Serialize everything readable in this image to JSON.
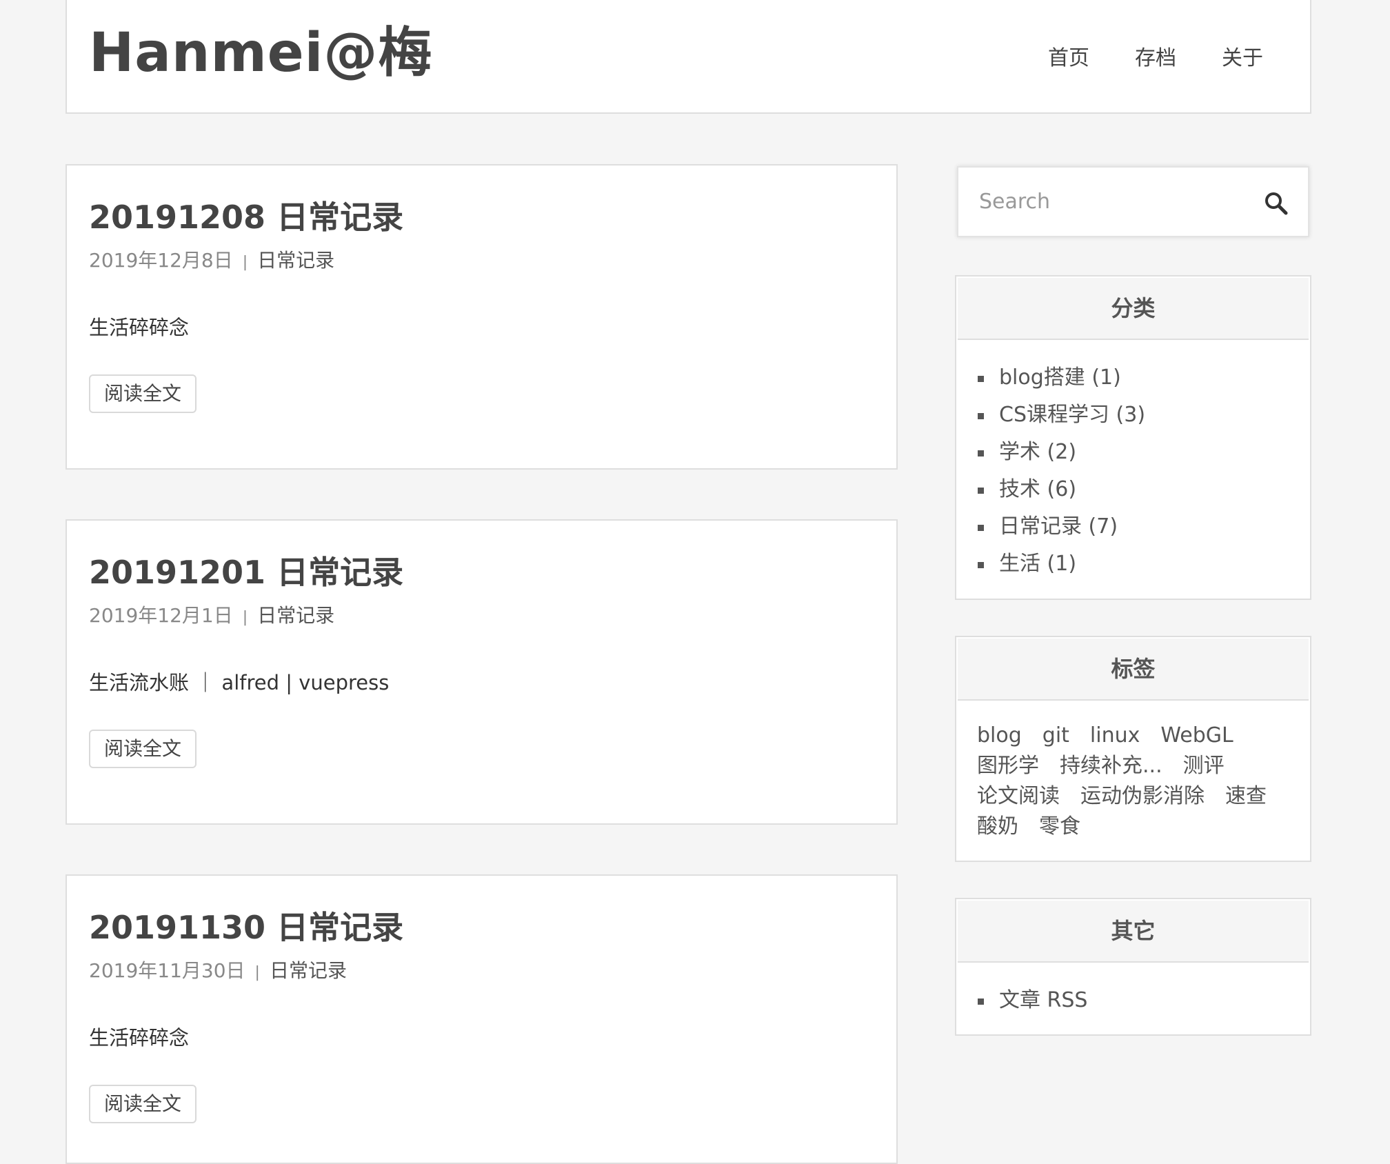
{
  "site": {
    "title": "Hanmei@梅"
  },
  "nav": {
    "items": [
      {
        "label": "首页"
      },
      {
        "label": "存档"
      },
      {
        "label": "关于"
      }
    ]
  },
  "posts": [
    {
      "title": "20191208 日常记录",
      "date": "2019年12月8日",
      "meta_separator": "|",
      "category": "日常记录",
      "excerpt": "生活碎碎念",
      "read_more": "阅读全文"
    },
    {
      "title": "20191201 日常记录",
      "date": "2019年12月1日",
      "meta_separator": "|",
      "category": "日常记录",
      "excerpt": "生活流水账 ｜ alfred | vuepress",
      "read_more": "阅读全文"
    },
    {
      "title": "20191130 日常记录",
      "date": "2019年11月30日",
      "meta_separator": "|",
      "category": "日常记录",
      "excerpt": "生活碎碎念",
      "read_more": "阅读全文"
    }
  ],
  "search": {
    "placeholder": "Search",
    "icon": "search-icon"
  },
  "categories": {
    "title": "分类",
    "items": [
      {
        "name": "blog搭建",
        "count": "(1)"
      },
      {
        "name": "CS课程学习",
        "count": "(3)"
      },
      {
        "name": "学术",
        "count": "(2)"
      },
      {
        "name": "技术",
        "count": "(6)"
      },
      {
        "name": "日常记录",
        "count": "(7)"
      },
      {
        "name": "生活",
        "count": "(1)"
      }
    ]
  },
  "tags": {
    "title": "标签",
    "items": [
      "blog",
      "git",
      "linux",
      "WebGL",
      "图形学",
      "持续补充...",
      "测评",
      "论文阅读",
      "运动伪影消除",
      "速查",
      "酸奶",
      "零食"
    ]
  },
  "other": {
    "title": "其它",
    "items": [
      {
        "label": "文章 RSS"
      }
    ]
  },
  "colors": {
    "background": "#f5f5f5",
    "card": "#ffffff",
    "border": "#dedede",
    "text": "#444444",
    "meta": "#888888"
  }
}
